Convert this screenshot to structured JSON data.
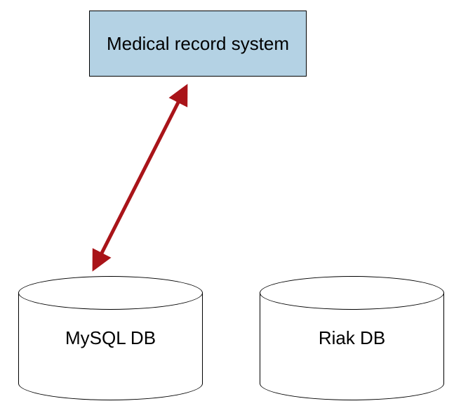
{
  "system_box": {
    "label": "Medical record system"
  },
  "db_left": {
    "label": "MySQL DB"
  },
  "db_right": {
    "label": "Riak DB"
  },
  "arrow_color": "#a91419"
}
